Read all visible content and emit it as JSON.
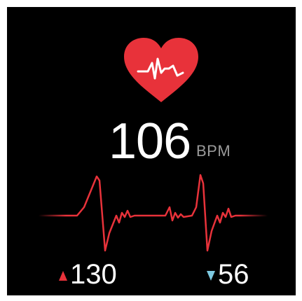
{
  "app": {
    "accent_color": "#e8323a",
    "background_color": "#000000",
    "heart_icon": "heart-pulse-icon"
  },
  "heart_rate": {
    "value": "106",
    "unit": "BPM"
  },
  "stats": {
    "max_icon": "arrow-up-icon",
    "max_value": "130",
    "max_color": "#e8323a",
    "min_icon": "arrow-down-icon",
    "min_value": "56",
    "min_color": "#7dc9e0"
  },
  "ecg": {
    "line_color": "#e8323a"
  }
}
